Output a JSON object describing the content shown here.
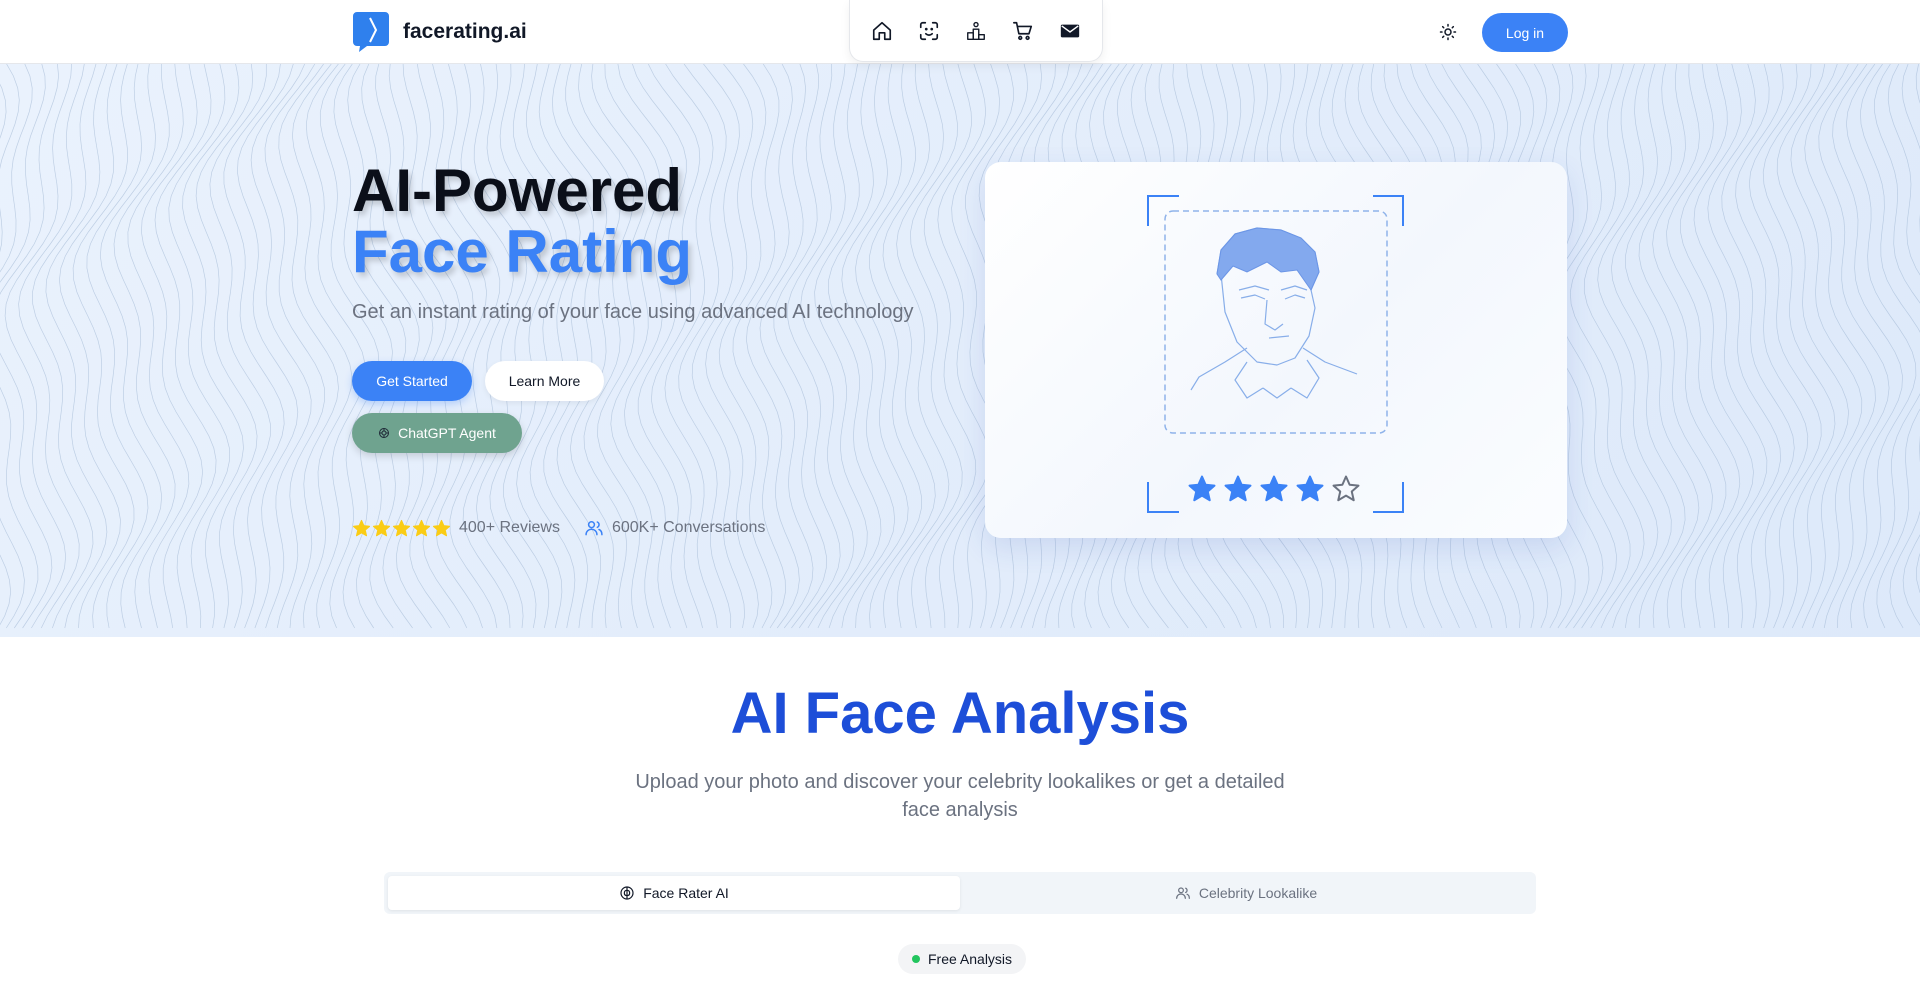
{
  "header": {
    "brand_name": "facerating.ai",
    "login_label": "Log in",
    "nav_icons": [
      "home-icon",
      "face-scan-icon",
      "podium-icon",
      "cart-icon",
      "mail-icon"
    ],
    "theme_icon": "sun-icon"
  },
  "hero": {
    "title_line1": "AI-Powered",
    "title_line2": "Face Rating",
    "subtitle": "Get an instant rating of your face using advanced AI technology",
    "get_started_label": "Get Started",
    "learn_more_label": "Learn More",
    "chatgpt_label": "ChatGPT Agent",
    "reviews_label": "400+ Reviews",
    "conversations_label": "600K+ Conversations",
    "review_stars": 5,
    "card_rating": 4,
    "card_rating_max": 5
  },
  "analysis": {
    "title": "AI Face Analysis",
    "subtitle": "Upload your photo and discover your celebrity lookalikes or get a detailed face analysis",
    "tabs": [
      {
        "label": "Face Rater AI",
        "icon": "brain-icon",
        "active": true
      },
      {
        "label": "Celebrity Lookalike",
        "icon": "users-icon",
        "active": false
      }
    ],
    "badge_label": "Free Analysis"
  },
  "colors": {
    "accent": "#3b82f6",
    "heading_blue": "#1d4ed8",
    "chatgpt_green": "#6fa38f",
    "star_yellow": "#facc15",
    "badge_dot": "#22c55e"
  }
}
